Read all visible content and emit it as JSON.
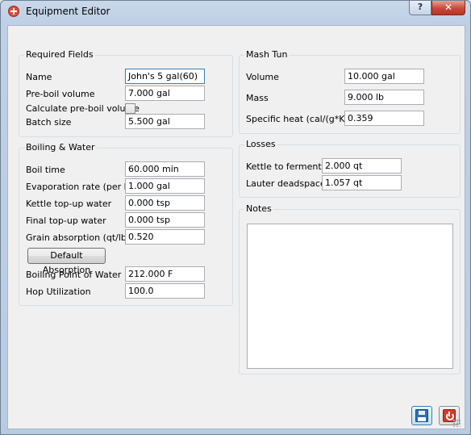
{
  "window": {
    "title": "Equipment Editor",
    "help_label": "?",
    "close_label": "✕"
  },
  "required": {
    "title": "Required Fields",
    "name_label": "Name",
    "name_value": "John's 5 gal(60)",
    "preboil_label": "Pre-boil volume",
    "preboil_value": "7.000 gal",
    "calc_label": "Calculate pre-boil volume",
    "calc_checked": false,
    "batch_label": "Batch size",
    "batch_value": "5.500 gal"
  },
  "boiling": {
    "title": "Boiling & Water",
    "boil_time_label": "Boil time",
    "boil_time_value": "60.000 min",
    "evap_label": "Evaporation rate (per hr)",
    "evap_value": "1.000 gal",
    "kettle_label": "Kettle top-up water",
    "kettle_value": "0.000 tsp",
    "final_label": "Final top-up water",
    "final_value": "0.000 tsp",
    "grain_label": "Grain absorption (qt/lb)",
    "grain_value": "0.520",
    "default_absorption_label": "Default Absorption",
    "bp_label": "Boiling Point of Water",
    "bp_value": "212.000 F",
    "hop_label": "Hop Utilization",
    "hop_value": "100.0"
  },
  "mash_tun": {
    "title": "Mash Tun",
    "volume_label": "Volume",
    "volume_value": "10.000 gal",
    "mass_label": "Mass",
    "mass_value": "9.000 lb",
    "heat_label": "Specific heat (cal/(g*K))",
    "heat_value": "0.359"
  },
  "losses": {
    "title": "Losses",
    "fermenter_label": "Kettle to fermenter",
    "fermenter_value": "2.000 qt",
    "lauter_label": "Lauter deadspace",
    "lauter_value": "1.057 qt"
  },
  "notes": {
    "title": "Notes",
    "value": ""
  },
  "colors": {
    "title_bar": "#bfd0e6",
    "close_button": "#c8493a",
    "focus_border": "#3c7fb1"
  },
  "icons": {
    "save": "floppy-disk",
    "cancel": "power"
  }
}
